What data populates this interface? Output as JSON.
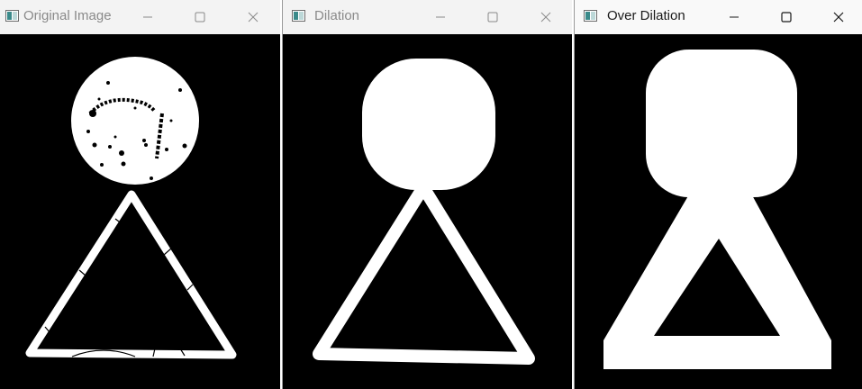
{
  "windows": [
    {
      "title": "Original Image",
      "active": false,
      "controls": {
        "minimize": "minimize-icon",
        "maximize": "maximize-icon",
        "close": "close-icon"
      },
      "content": "binary image with noisy circle and thin triangle outline"
    },
    {
      "title": "Dilation",
      "active": false,
      "controls": {
        "minimize": "minimize-icon",
        "maximize": "maximize-icon",
        "close": "close-icon"
      },
      "content": "dilated binary image with filled circle and triangle outline"
    },
    {
      "title": "Over Dilation",
      "active": true,
      "controls": {
        "minimize": "minimize-icon",
        "maximize": "maximize-icon",
        "close": "close-icon"
      },
      "content": "over-dilated binary image with merged blob and thick triangle"
    }
  ],
  "colors": {
    "titlebar_inactive": "#f3f3f3",
    "titlebar_active": "#f9f9f9",
    "title_inactive": "#8a8a8a",
    "title_active": "#1a1a1a",
    "image_background": "#000000",
    "image_foreground": "#ffffff"
  }
}
